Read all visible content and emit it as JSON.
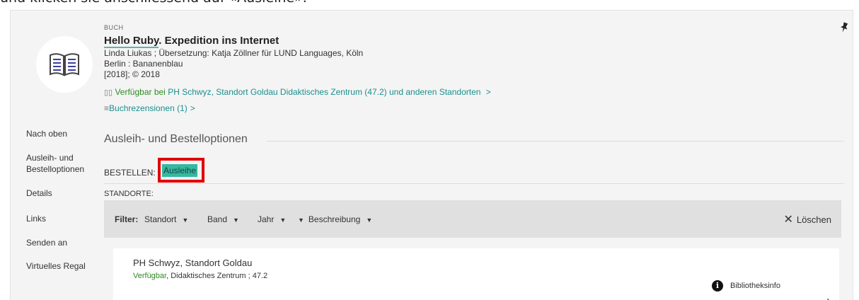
{
  "caption": "und klicken sie anschliessend auf «Ausleihe».",
  "record": {
    "type": "BUCH",
    "title_part1": "Hello Ruby",
    "title_part2": ". Expedition ins Internet",
    "authors": "Linda Liukas ; Übersetzung: Katja Zöllner für LUND Languages, Köln",
    "publisher": "Berlin : Bananenblau",
    "date": "[2018]; © 2018",
    "availability_prefix": "Verfügbar bei",
    "availability_location": "PH Schwyz, Standort Goldau  Didaktisches Zentrum (47.2) und anderen Standorten",
    "chevron": ">",
    "reviews": "Buchrezensionen (1)"
  },
  "nav": [
    "Nach oben",
    "Ausleih- und",
    "Bestelloptionen",
    "Details",
    "Links",
    "Senden an",
    "Virtuelles Regal"
  ],
  "section_title": "Ausleih- und Bestelloptionen",
  "order": {
    "label": "BESTELLEN:",
    "button": "Ausleihe"
  },
  "standorte_label": "STANDORTE:",
  "filter": {
    "label": "Filter:",
    "items": [
      "Standort",
      "Band",
      "Jahr",
      "Beschreibung"
    ],
    "clear": "Löschen"
  },
  "location": {
    "name": "PH Schwyz, Standort Goldau",
    "status": "Verfügbar",
    "detail": ", Didaktisches Zentrum ; 47.2",
    "info": "Bibliotheksinfo"
  },
  "colors": {
    "accent_teal": "#38b7a0",
    "highlight_red": "#e00000",
    "available_green": "#2e8b22",
    "link_teal": "#1a8f8c"
  }
}
